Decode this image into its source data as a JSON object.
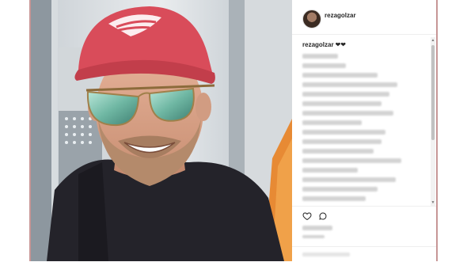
{
  "post": {
    "username": "rezagolzar",
    "caption_user": "rezagolzar",
    "caption_hearts": "❤❤"
  },
  "icons": {
    "like": "heart-icon",
    "comment": "comment-icon"
  },
  "colors": {
    "frame_border": "#c79696",
    "cap_red": "#d94c5a",
    "lens": "#7fc7b6"
  }
}
